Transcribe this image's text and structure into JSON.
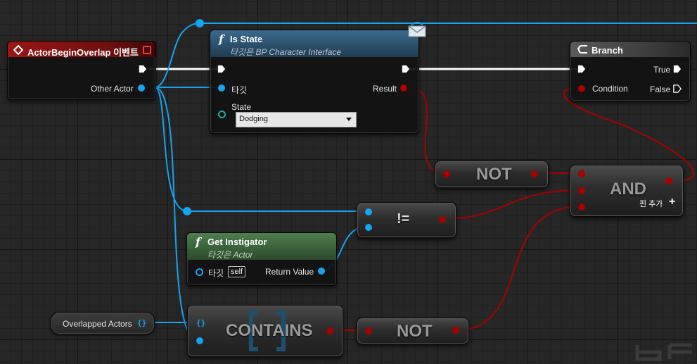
{
  "nodes": {
    "event": {
      "title": "ActorBeginOverlap 이벤트",
      "output_label": "Other Actor"
    },
    "is_state": {
      "title": "Is State",
      "subtitle": "타깃은 BP Character Interface",
      "target_label": "타깃",
      "state_label": "State",
      "state_value": "Dodging",
      "result_label": "Result"
    },
    "branch": {
      "title": "Branch",
      "condition_label": "Condition",
      "true_label": "True",
      "false_label": "False"
    },
    "not_top": {
      "label": "NOT"
    },
    "and": {
      "label": "AND",
      "add_pin_label": "핀 추가"
    },
    "not_equal": {
      "label": "!="
    },
    "get_instigator": {
      "title": "Get Instigator",
      "subtitle": "타깃은 Actor",
      "target_label": "타깃",
      "self_label": "self",
      "return_label": "Return Value"
    },
    "overlapped_actors": {
      "label": "Overlapped Actors"
    },
    "contains": {
      "label": "CONTAINS"
    },
    "not_bottom": {
      "label": "NOT"
    }
  },
  "icons": {
    "event": "event-diamond-icon",
    "function": "function-f-icon",
    "message": "envelope-icon",
    "branch": "branch-arrow-icon",
    "add_pin": "plus-icon"
  },
  "colors": {
    "event_header": "#8a1010",
    "function_header": "#2f5572",
    "pure_header": "#3e6a3e",
    "object_pin": "#16a3f0",
    "bool_pin": "#a50000",
    "enum_pin": "#1fa89e",
    "exec_wire": "#ffffff"
  }
}
